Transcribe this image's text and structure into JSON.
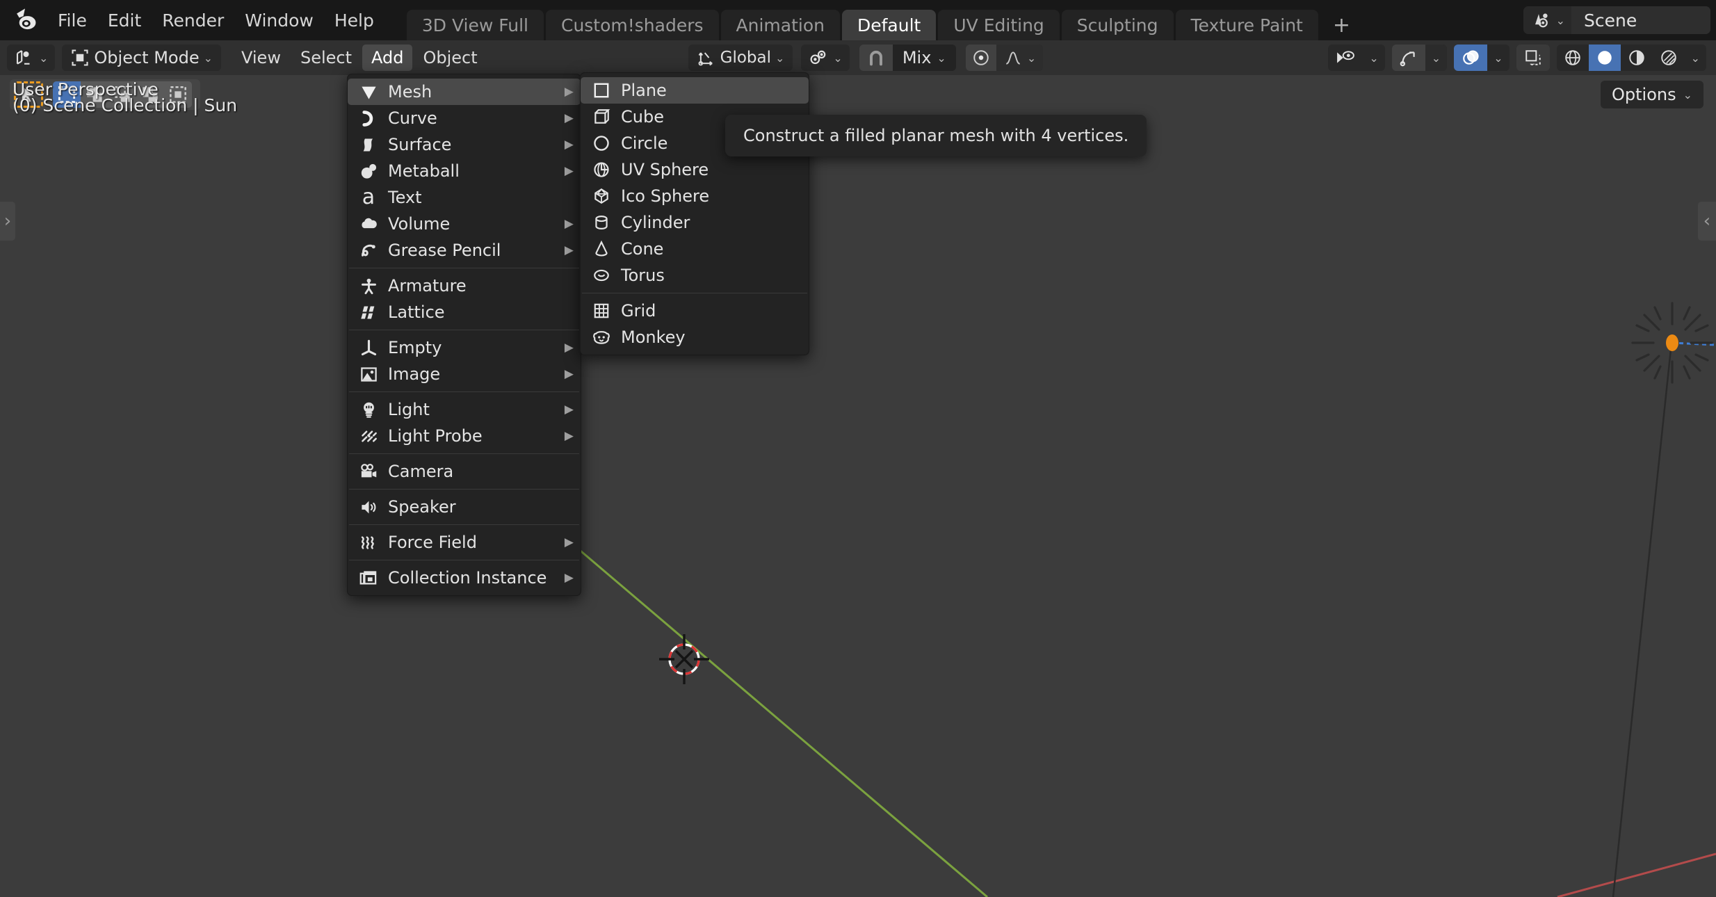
{
  "topbar": {
    "logo_icon": "blender-logo-icon",
    "menus": [
      "File",
      "Edit",
      "Render",
      "Window",
      "Help"
    ],
    "workspace_tabs": [
      {
        "label": "3D View Full",
        "active": false
      },
      {
        "label": "Custom!shaders",
        "active": false
      },
      {
        "label": "Animation",
        "active": false
      },
      {
        "label": "Default",
        "active": true
      },
      {
        "label": "UV Editing",
        "active": false
      },
      {
        "label": "Sculpting",
        "active": false
      },
      {
        "label": "Texture Paint",
        "active": false
      }
    ],
    "add_workspace_label": "+",
    "scene": {
      "browse_icon": "scene-browse-icon",
      "name": "Scene"
    }
  },
  "viewheader": {
    "editor_type_icon": "editor-type-3dview-icon",
    "mode": {
      "icon": "object-mode-icon",
      "label": "Object Mode"
    },
    "menus": [
      {
        "label": "View",
        "active": false
      },
      {
        "label": "Select",
        "active": false
      },
      {
        "label": "Add",
        "active": true
      },
      {
        "label": "Object",
        "active": false
      }
    ],
    "transform_orientation": {
      "icon": "orientation-global-icon",
      "label": "Global"
    },
    "pivot": {
      "icon": "pivot-point-icon"
    },
    "snap": {
      "magnet_icon": "magnet-icon",
      "label": "Mix"
    },
    "proportional_edit": {
      "icon": "proportional-edit-icon",
      "falloff_icon": "falloff-smooth-icon"
    },
    "right_tools": {
      "visibility_icon": "object-visibility-icon",
      "gizmo_icon": "gizmo-icon",
      "overlays_icon": "overlays-icon",
      "overlays_on": true,
      "xray_icon": "xray-toggle-icon",
      "shading_modes": [
        {
          "icon": "shading-wireframe-icon",
          "active": false
        },
        {
          "icon": "shading-solid-icon",
          "active": true
        },
        {
          "icon": "shading-material-preview-icon",
          "active": false
        },
        {
          "icon": "shading-rendered-icon",
          "active": false
        }
      ]
    }
  },
  "toolsettings": {
    "active_tool_icon": "cursor-select-tool-icon",
    "select_modes": [
      {
        "icon": "select-new-icon",
        "active": true
      },
      {
        "icon": "select-extend-icon",
        "active": false
      },
      {
        "icon": "select-subtract-icon",
        "active": false
      },
      {
        "icon": "select-invert-icon",
        "active": false
      },
      {
        "icon": "select-intersect-icon",
        "active": false
      }
    ],
    "options_label": "Options"
  },
  "viewport": {
    "perspective_label": "User Perspective",
    "collection_label": "(0) Scene Collection | Sun",
    "left_panel_toggle_icon": "chevron-right-icon",
    "right_panel_toggle_icon": "chevron-left-icon",
    "objects": [
      {
        "name": "sun-light-gizmo",
        "color": "#ec8a13"
      },
      {
        "name": "3d-cursor",
        "color": "#dd3333"
      }
    ],
    "axis_lines": [
      {
        "name": "y-axis-line",
        "color": "#7ba23f"
      },
      {
        "name": "x-axis-line",
        "color": "#b34b4b"
      }
    ],
    "bg_color": "#3c3c3c"
  },
  "add_menu": {
    "items": [
      {
        "label": "Mesh",
        "icon": "mesh-data-icon",
        "submenu": true,
        "highlighted": true
      },
      {
        "label": "Curve",
        "icon": "curve-data-icon",
        "submenu": true
      },
      {
        "label": "Surface",
        "icon": "surface-data-icon",
        "submenu": true
      },
      {
        "label": "Metaball",
        "icon": "metaball-data-icon",
        "submenu": true
      },
      {
        "label": "Text",
        "icon": "font-data-icon",
        "submenu": false
      },
      {
        "label": "Volume",
        "icon": "volume-data-icon",
        "submenu": true
      },
      {
        "label": "Grease Pencil",
        "icon": "grease-pencil-icon",
        "submenu": true
      },
      {
        "separator": true
      },
      {
        "label": "Armature",
        "icon": "armature-data-icon",
        "submenu": false
      },
      {
        "label": "Lattice",
        "icon": "lattice-data-icon",
        "submenu": false
      },
      {
        "separator": true
      },
      {
        "label": "Empty",
        "icon": "empty-axis-icon",
        "submenu": true
      },
      {
        "label": "Image",
        "icon": "image-data-icon",
        "submenu": true
      },
      {
        "separator": true
      },
      {
        "label": "Light",
        "icon": "light-data-icon",
        "submenu": true
      },
      {
        "label": "Light Probe",
        "icon": "light-probe-icon",
        "submenu": true
      },
      {
        "separator": true
      },
      {
        "label": "Camera",
        "icon": "camera-data-icon",
        "submenu": false
      },
      {
        "separator": true
      },
      {
        "label": "Speaker",
        "icon": "speaker-icon",
        "submenu": false
      },
      {
        "separator": true
      },
      {
        "label": "Force Field",
        "icon": "force-field-icon",
        "submenu": true
      },
      {
        "separator": true
      },
      {
        "label": "Collection Instance",
        "icon": "collection-instance-icon",
        "submenu": true
      }
    ]
  },
  "mesh_submenu": {
    "items": [
      {
        "label": "Plane",
        "icon": "mesh-plane-icon",
        "highlighted": true
      },
      {
        "label": "Cube",
        "icon": "mesh-cube-icon"
      },
      {
        "label": "Circle",
        "icon": "mesh-circle-icon"
      },
      {
        "label": "UV Sphere",
        "icon": "mesh-uvsphere-icon"
      },
      {
        "label": "Ico Sphere",
        "icon": "mesh-icosphere-icon"
      },
      {
        "label": "Cylinder",
        "icon": "mesh-cylinder-icon"
      },
      {
        "label": "Cone",
        "icon": "mesh-cone-icon"
      },
      {
        "label": "Torus",
        "icon": "mesh-torus-icon"
      },
      {
        "separator": true
      },
      {
        "label": "Grid",
        "icon": "mesh-grid-icon"
      },
      {
        "label": "Monkey",
        "icon": "mesh-monkey-icon"
      }
    ]
  },
  "tooltip": {
    "text": "Construct a filled planar mesh with 4 vertices."
  },
  "colors": {
    "accent_blue": "#4772b3",
    "accent_orange": "#ec9c20",
    "topbar_bg": "#181818",
    "header_bg": "#303030",
    "viewport_bg": "#3c3c3c",
    "menu_bg": "#232323"
  }
}
